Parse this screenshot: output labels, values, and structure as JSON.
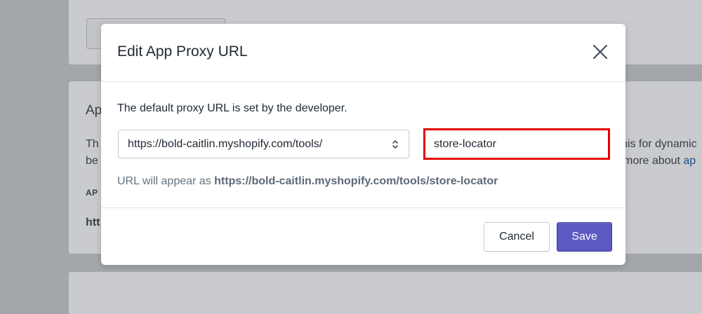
{
  "background": {
    "heading_fragment": "Ap",
    "line1_left": "Th",
    "line1_right": "his for dynamic",
    "line2_left": "be",
    "line2_right": "more about ",
    "line2_link": "ap",
    "caps_fragment": "AP",
    "bold_fragment": "htt"
  },
  "modal": {
    "title": "Edit App Proxy URL",
    "description": "The default proxy URL is set by the developer.",
    "proxy_select": {
      "value": "https://bold-caitlin.myshopify.com/tools/"
    },
    "subpath_input": {
      "value": "store-locator"
    },
    "preview_prefix": "URL will appear as ",
    "preview_url": "https://bold-caitlin.myshopify.com/tools/store-locator",
    "cancel_label": "Cancel",
    "save_label": "Save"
  },
  "colors": {
    "primary": "#5c59c2",
    "highlight": "#e60000",
    "overlay": "#a3a6aa"
  },
  "icons": {
    "close": "close-icon",
    "select": "select-arrows-icon"
  }
}
